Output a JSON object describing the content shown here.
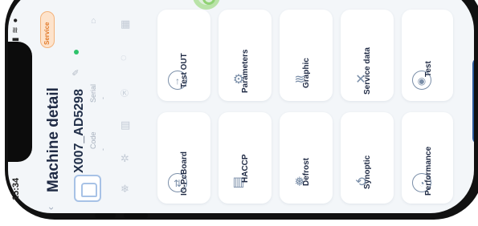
{
  "status_bar": {
    "time": "15:34",
    "icons": "signal-wifi-battery"
  },
  "header": {
    "back_icon": "chevron-left-icon",
    "title": "Machine detail"
  },
  "machine": {
    "name": "X007_AD5298",
    "code_label": "Code",
    "serial_label": "Serial",
    "code_value": "-",
    "serial_value": "-",
    "status_color": "#2ec36b",
    "badge": "Service"
  },
  "side_icons": [
    "lock-icon",
    "grid-icon",
    "power-icon",
    "kg-icon",
    "calendar-icon",
    "fan-icon",
    "snowflake-icon"
  ],
  "tiles": [
    {
      "label": "Test OUT",
      "icon": "arrow-up-circle-icon"
    },
    {
      "label": "Parameters",
      "icon": "gears-icon"
    },
    {
      "label": "Graphic",
      "icon": "waves-icon"
    },
    {
      "label": "Service data",
      "icon": "tools-icon"
    },
    {
      "label": "Test",
      "icon": "eye-circle-icon"
    },
    {
      "label": "IO-PcBoard",
      "icon": "arrows-updown-circle-icon"
    },
    {
      "label": "HACCP",
      "icon": "chart-clock-icon"
    },
    {
      "label": "Defrost",
      "icon": "snow-drops-icon"
    },
    {
      "label": "Synoptic",
      "icon": "cycle-icon"
    },
    {
      "label": "Performance",
      "icon": "gauge-icon"
    }
  ],
  "accent": "#2b5b9e"
}
